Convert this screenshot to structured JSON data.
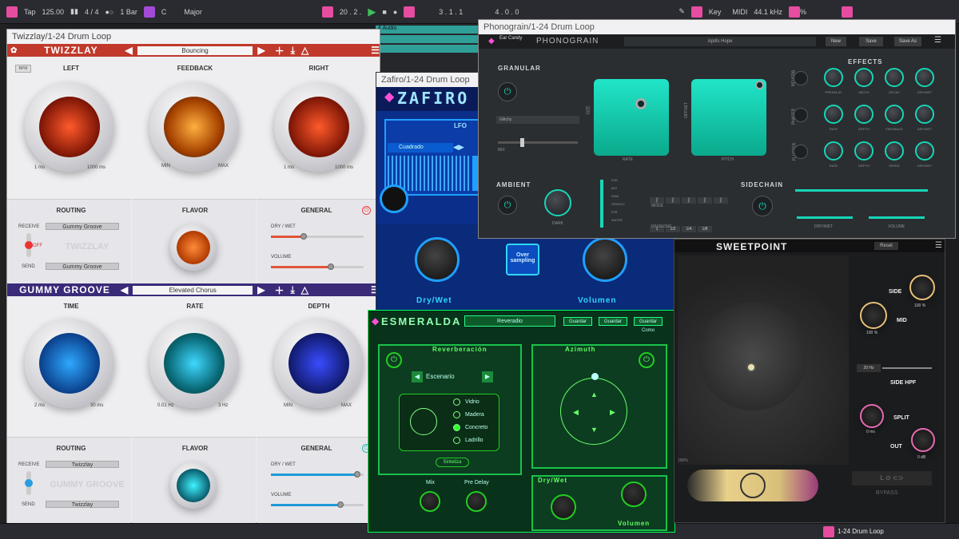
{
  "daw": {
    "tap": "Tap",
    "bpm": "125.00",
    "time_sig": "4 / 4",
    "quantize": "1 Bar",
    "key": "C",
    "scale": "Major",
    "position": "20 . 2 .",
    "loop_start": "3 . 1 . 1",
    "loop_end": "4 . 0 . 0",
    "key_label": "Key",
    "midi_label": "MIDI",
    "sample_rate": "44.1 kHz",
    "cpu_label": "%",
    "track_name": "1-24 Drum Loop",
    "track_header": "4 Audio"
  },
  "twizzlay": {
    "window_title": "Twizzlay/1-24 Drum Loop",
    "name": "TWIZZLAY",
    "preset": "Bouncing",
    "bpm_label": "BPM",
    "left_label": "LEFT",
    "feedback_label": "FEEDBACK",
    "right_label": "RIGHT",
    "left_min": "1 ms",
    "left_max": "1000 ms",
    "fb_min": "MIN",
    "fb_max": "MAX",
    "right_min": "1 ms",
    "right_max": "1000 ms",
    "routing_label": "ROUTING",
    "receive_label": "RECEIVE",
    "receive_value": "Gummy Groove",
    "off_label": "OFF",
    "ghost_name": "TWIZZLAY",
    "send_label": "SEND",
    "send_value": "Gummy Groove",
    "flavor_label": "FLAVOR",
    "general_label": "GENERAL",
    "drywet_label": "DRY / WET",
    "volume_label": "VOLUME",
    "drywet": 0.35,
    "volume": 0.65,
    "colors": {
      "header": "#c0392b"
    }
  },
  "gummy": {
    "name": "GUMMY GROOVE",
    "preset": "Elevated Chorus",
    "time_label": "TIME",
    "rate_label": "RATE",
    "depth_label": "DEPTH",
    "time_min": "2 ms",
    "time_max": "30 ms",
    "rate_min": "0.01 Hz",
    "rate_max": "3 Hz",
    "depth_min": "MIN",
    "depth_max": "MAX",
    "routing_label": "ROUTING",
    "receive_label": "RECEIVE",
    "receive_value": "Twizzlay",
    "ghost_name": "GUMMY GROOVE",
    "send_label": "SEND",
    "send_value": "Twizzlay",
    "flavor_label": "FLAVOR",
    "general_label": "GENERAL",
    "drywet_label": "DRY / WET",
    "volume_label": "VOLUME",
    "drywet": 0.93,
    "volume": 0.75,
    "colors": {
      "header": "#3a2a78"
    }
  },
  "zafiro": {
    "window_title": "Zafiro/1-24 Drum Loop",
    "name": "ZAFIRO",
    "lfo_label": "LFO",
    "shape": "Cuadrado",
    "sync_button": "Over sampling",
    "drywet_label": "Dry/Wet",
    "volume_label": "Volumen"
  },
  "esmeralda": {
    "name": "ESMERALDA",
    "preset": "Reveradio",
    "btn1": "Guardar",
    "btn2": "Guardar",
    "btn3": "Guardar Como",
    "reverb_label": "Reverberación",
    "azimuth_label": "Azimuth",
    "scene_label": "Escenario",
    "materials": [
      "Vidrio",
      "Madera",
      "Concreto",
      "Ladrillo"
    ],
    "selected_material": "Concreto",
    "sinth_label": "Sintetiza",
    "mix_label": "Mix",
    "predelay_label": "Pre Delay",
    "drywet_label": "Dry/Wet",
    "volume_label": "Volumen"
  },
  "phonograin": {
    "window_title": "Phonograin/1-24 Drum Loop",
    "brand": "Ear Candy",
    "name": "PHONOGRAIN",
    "preset": "Aprils Hope",
    "btn_new": "New",
    "btn_save": "Save",
    "btn_saveas": "Save As",
    "granular_label": "GRANULAR",
    "glitch_value": "Glitchy",
    "mix_label": "MIX",
    "size_label": "SIZE",
    "rate_label": "RATE",
    "offset_label": "OFFSET",
    "pitch_label": "PITCH",
    "ambient_label": "AMBIENT",
    "dark_label": "DARK",
    "modes": [
      "FAN",
      "MIX",
      "RAW",
      "GREEDY",
      "FFB",
      "WATER"
    ],
    "mode_label": "MODE",
    "divisions_label": "DIVISIONS",
    "divisions": [
      "1",
      "1/2",
      "1/4",
      "1/8"
    ],
    "sidechain_label": "SIDECHAIN",
    "effects_label": "EFFECTS",
    "reverb_label": "REVERB",
    "phaser_label": "PHASER",
    "flutter_label": "FLUTTER",
    "fx_row1": [
      "PREDELAY",
      "WIDTH",
      "DECAY",
      "DRY/WET"
    ],
    "fx_row2": [
      "RATE",
      "DEPTH",
      "FEEDBACK",
      "DRY/WET"
    ],
    "fx_row3": [
      "RATE",
      "DEPTH",
      "SPEED",
      "DRY/WET"
    ],
    "drywet_label": "DRY/WET",
    "volume_label": "VOLUME"
  },
  "sweetpoint": {
    "name": "SWEETPOINT",
    "reset": "Reset",
    "side_label": "SIDE",
    "side_value": "100 %",
    "mid_label": "MID",
    "mid_value": "100 %",
    "hpf_value": "20 Hz",
    "hpf_label": "SIDE HPF",
    "split_label": "SPLIT",
    "split_value": "0 ms",
    "out_label": "OUT",
    "out_value": "0 dB",
    "bypass_label": "BYPASS",
    "percent_label": "100%"
  }
}
